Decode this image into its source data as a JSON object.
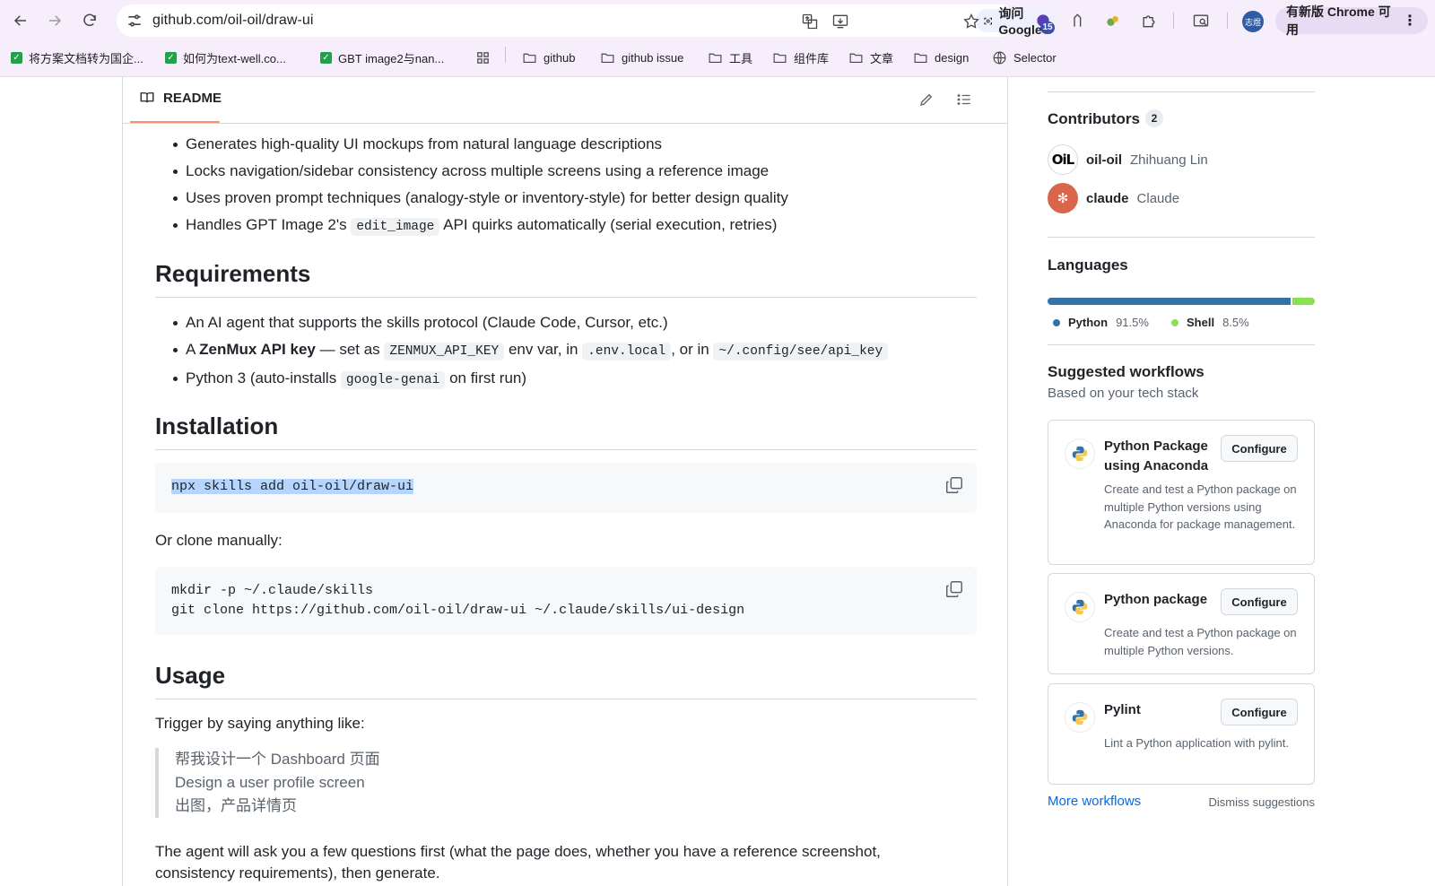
{
  "browser": {
    "url": "github.com/oil-oil/draw-ui",
    "ask_google": "询问 Google",
    "extension_badge": "15",
    "profile_text": "志煜",
    "update_button": "有新版 Chrome 可用",
    "bookmarks": [
      {
        "type": "check",
        "label": "将方案文档转为国企..."
      },
      {
        "type": "check",
        "label": "如何为text-well.co..."
      },
      {
        "type": "check",
        "label": "GBT image2与nan..."
      },
      {
        "type": "apps",
        "label": ""
      },
      {
        "type": "folder",
        "label": "github"
      },
      {
        "type": "folder",
        "label": "github issue"
      },
      {
        "type": "folder",
        "label": "工具"
      },
      {
        "type": "folder",
        "label": "组件库"
      },
      {
        "type": "folder",
        "label": "文章"
      },
      {
        "type": "folder",
        "label": "design"
      },
      {
        "type": "globe",
        "label": "Selector"
      }
    ]
  },
  "readme": {
    "tab_label": "README",
    "intro_bullets": [
      {
        "pre": "Generates high-quality UI mockups from natural language descriptions",
        "code": "",
        "post": ""
      },
      {
        "pre": "Locks navigation/sidebar consistency across multiple screens using a reference image",
        "code": "",
        "post": ""
      },
      {
        "pre": "Uses proven prompt techniques (analogy-style or inventory-style) for better design quality",
        "code": "",
        "post": ""
      },
      {
        "pre": "Handles GPT Image 2's ",
        "code": "edit_image",
        "post": " API quirks automatically (serial execution, retries)"
      }
    ],
    "requirements": {
      "heading": "Requirements",
      "item1": "An AI agent that supports the skills protocol (Claude Code, Cursor, etc.)",
      "item2_a": "A ",
      "item2_bold": "ZenMux API key",
      "item2_b": " — set as ",
      "item2_code1": "ZENMUX_API_KEY",
      "item2_c": " env var, in ",
      "item2_code2": ".env.local",
      "item2_d": ", or in ",
      "item2_code3": "~/.config/see/api_key",
      "item3_a": "Python 3 (auto-installs ",
      "item3_code": "google-genai",
      "item3_b": " on first run)"
    },
    "installation": {
      "heading": "Installation",
      "command": "npx skills add oil-oil/draw-ui",
      "or_clone": "Or clone manually:",
      "clone_line1": "mkdir -p ~/.claude/skills",
      "clone_line2": "git clone https://github.com/oil-oil/draw-ui ~/.claude/skills/ui-design"
    },
    "usage": {
      "heading": "Usage",
      "trigger": "Trigger by saying anything like:",
      "quotes": [
        "帮我设计一个 Dashboard 页面",
        "Design a user profile screen",
        "出图，产品详情页"
      ],
      "agent_line1": "The agent will ask you a few questions first (what the page does, whether you have a reference screenshot,",
      "agent_line2": "consistency requirements), then generate."
    }
  },
  "sidebar": {
    "contributors_heading": "Contributors",
    "contributors_count": "2",
    "contributors": [
      {
        "login": "oil-oil",
        "name": "Zhihuang Lin",
        "avatar_text": "OiL"
      },
      {
        "login": "claude",
        "name": "Claude",
        "avatar_text": "✻"
      }
    ],
    "languages_heading": "Languages",
    "languages": [
      {
        "name": "Python",
        "percent": "91.5%",
        "value": 91.5,
        "color": "#3572A5"
      },
      {
        "name": "Shell",
        "percent": "8.5%",
        "value": 8.5,
        "color": "#89e051"
      }
    ],
    "workflows_heading": "Suggested workflows",
    "workflows_sub": "Based on your tech stack",
    "workflows": [
      {
        "title": "Python Package using Anaconda",
        "desc": "Create and test a Python package on multiple Python versions using Anaconda for package management.",
        "button": "Configure"
      },
      {
        "title": "Python package",
        "desc": "Create and test a Python package on multiple Python versions.",
        "button": "Configure"
      },
      {
        "title": "Pylint",
        "desc": "Lint a Python application with pylint.",
        "button": "Configure"
      }
    ],
    "more_workflows": "More workflows",
    "dismiss": "Dismiss suggestions"
  }
}
